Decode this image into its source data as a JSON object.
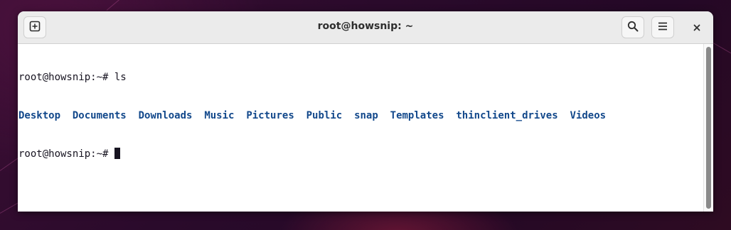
{
  "window": {
    "title": "root@howsnip: ~"
  },
  "icons": {
    "new_tab": "new-tab-icon",
    "search": "search-icon",
    "menu": "hamburger-menu-icon",
    "close": "close-icon"
  },
  "terminal": {
    "lines": [
      {
        "prompt": "root@howsnip:~# ",
        "command": "ls"
      },
      {
        "prompt": "root@howsnip:~# ",
        "command": ""
      }
    ],
    "ls_output": [
      "Desktop",
      "Documents",
      "Downloads",
      "Music",
      "Pictures",
      "Public",
      "snap",
      "Templates",
      "thinclient_drives",
      "Videos"
    ]
  },
  "colors": {
    "directory": "#12488b",
    "text": "#171421",
    "background": "#ffffff"
  }
}
